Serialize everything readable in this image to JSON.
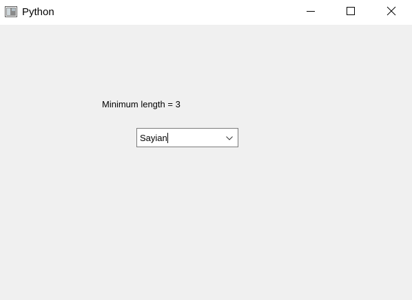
{
  "window": {
    "title": "Python",
    "app_icon": "python-tk-window-icon",
    "controls": {
      "minimize_icon": "minimize-icon",
      "maximize_icon": "maximize-icon",
      "close_icon": "close-icon"
    }
  },
  "main": {
    "label": "Minimum length = 3",
    "combobox": {
      "value": "Sayian",
      "dropdown_icon": "chevron-down-icon"
    }
  },
  "colors": {
    "titlebar_bg": "#ffffff",
    "window_bg": "#f0f0f0",
    "input_border": "#7a7a7a"
  }
}
